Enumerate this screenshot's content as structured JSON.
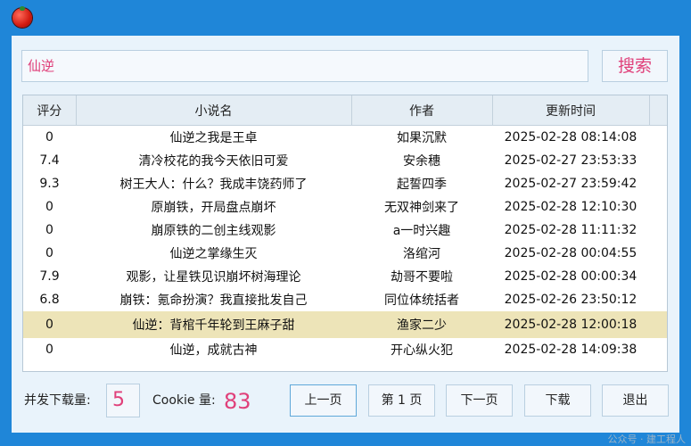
{
  "search": {
    "query": "仙逆",
    "button_label": "搜索"
  },
  "table": {
    "headers": [
      "评分",
      "小说名",
      "作者",
      "更新时间"
    ],
    "rows": [
      {
        "score": "0",
        "title": "仙逆之我是王卓",
        "author": "如果沉默",
        "updated": "2025-02-28 08:14:08"
      },
      {
        "score": "7.4",
        "title": "清冷校花的我今天依旧可爱",
        "author": "安余穗",
        "updated": "2025-02-27 23:53:33"
      },
      {
        "score": "9.3",
        "title": "树王大人：什么？我成丰饶药师了",
        "author": "起誓四季",
        "updated": "2025-02-27 23:59:42"
      },
      {
        "score": "0",
        "title": "原崩铁，开局盘点崩坏",
        "author": "无双神剑来了",
        "updated": "2025-02-28 12:10:30"
      },
      {
        "score": "0",
        "title": "崩原铁的二创主线观影",
        "author": "a一时兴趣",
        "updated": "2025-02-28 11:11:32"
      },
      {
        "score": "0",
        "title": "仙逆之掌缘生灭",
        "author": "洛绾河",
        "updated": "2025-02-28 00:04:55"
      },
      {
        "score": "7.9",
        "title": "观影，让星铁见识崩坏树海理论",
        "author": "劫哥不要啦",
        "updated": "2025-02-28 00:00:34"
      },
      {
        "score": "6.8",
        "title": "崩铁：氪命扮演？我直接批发自己",
        "author": "同位体统括者",
        "updated": "2025-02-26 23:50:12"
      },
      {
        "score": "0",
        "title": "仙逆：背棺千年轮到王麻子甜",
        "author": "渔家二少",
        "updated": "2025-02-28 12:00:18"
      },
      {
        "score": "0",
        "title": "仙逆，成就古神",
        "author": "开心纵火犯",
        "updated": "2025-02-28 14:09:38"
      }
    ],
    "selected_index": 8
  },
  "footer": {
    "concurrency_label": "并发下载量:",
    "concurrency_value": "5",
    "cookie_label": "Cookie 量:",
    "cookie_value": "83",
    "prev_label": "上一页",
    "page_label": "第 1 页",
    "next_label": "下一页",
    "download_label": "下载",
    "exit_label": "退出"
  },
  "watermark": "公众号 · 建工程人",
  "colors": {
    "accent": "#e0407a",
    "selected_row": "#ede4b8",
    "window_border": "#1f86d8"
  }
}
